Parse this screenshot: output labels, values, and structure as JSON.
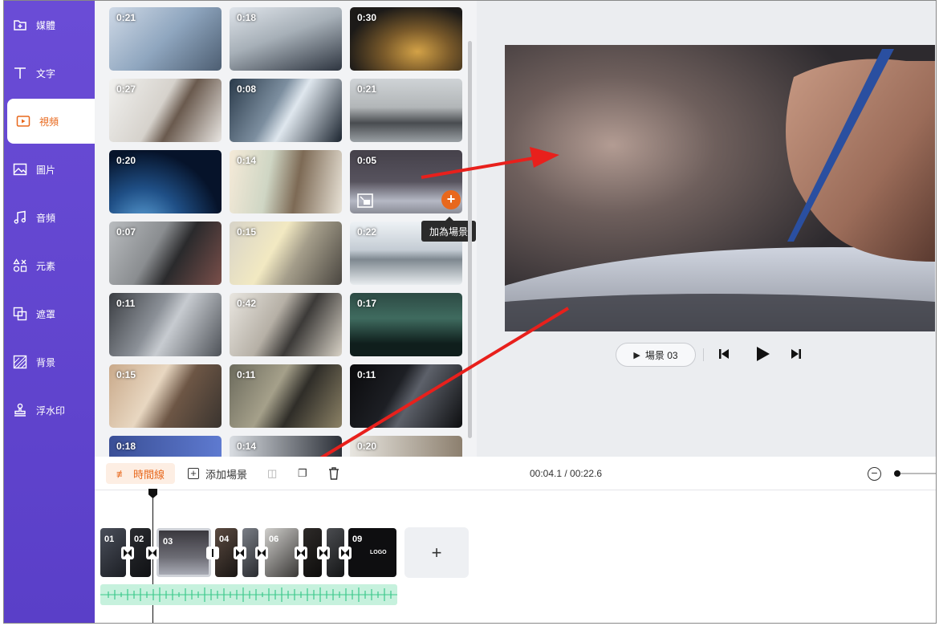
{
  "sidebar": {
    "items": [
      {
        "label": "媒體",
        "icon": "media-add-icon"
      },
      {
        "label": "文字",
        "icon": "text-icon"
      },
      {
        "label": "視頻",
        "icon": "video-icon",
        "active": true
      },
      {
        "label": "圖片",
        "icon": "image-icon"
      },
      {
        "label": "音頻",
        "icon": "music-icon"
      },
      {
        "label": "元素",
        "icon": "elements-icon"
      },
      {
        "label": "遮罩",
        "icon": "mask-icon"
      },
      {
        "label": "背景",
        "icon": "background-icon"
      },
      {
        "label": "浮水印",
        "icon": "watermark-stamp-icon"
      }
    ]
  },
  "videos": [
    {
      "duration": "0:21"
    },
    {
      "duration": "0:18"
    },
    {
      "duration": "0:30"
    },
    {
      "duration": "0:27"
    },
    {
      "duration": "0:08"
    },
    {
      "duration": "0:21"
    },
    {
      "duration": "0:20"
    },
    {
      "duration": "0:14"
    },
    {
      "duration": "0:05"
    },
    {
      "duration": "0:07"
    },
    {
      "duration": "0:15"
    },
    {
      "duration": "0:22"
    },
    {
      "duration": "0:11"
    },
    {
      "duration": "0:42"
    },
    {
      "duration": "0:17"
    },
    {
      "duration": "0:15"
    },
    {
      "duration": "0:11"
    },
    {
      "duration": "0:11"
    },
    {
      "duration": "0:18"
    },
    {
      "duration": "0:14"
    },
    {
      "duration": "0:20"
    }
  ],
  "tooltip": "加為場景",
  "preview": {
    "scene_label": "場景 03"
  },
  "timeline": {
    "timeline_label": "時間線",
    "add_scene_label": "添加場景",
    "time": "00:04.1 / 00:22.6",
    "clips": [
      "01",
      "02",
      "03",
      "04",
      "06",
      "09"
    ],
    "add_button": "+",
    "logo_text": "LOGO"
  },
  "colors": {
    "sidebar": "#5a3fc8",
    "accent": "#e8681c",
    "arrow": "#e8201c",
    "waveform": "#3cc98b"
  }
}
